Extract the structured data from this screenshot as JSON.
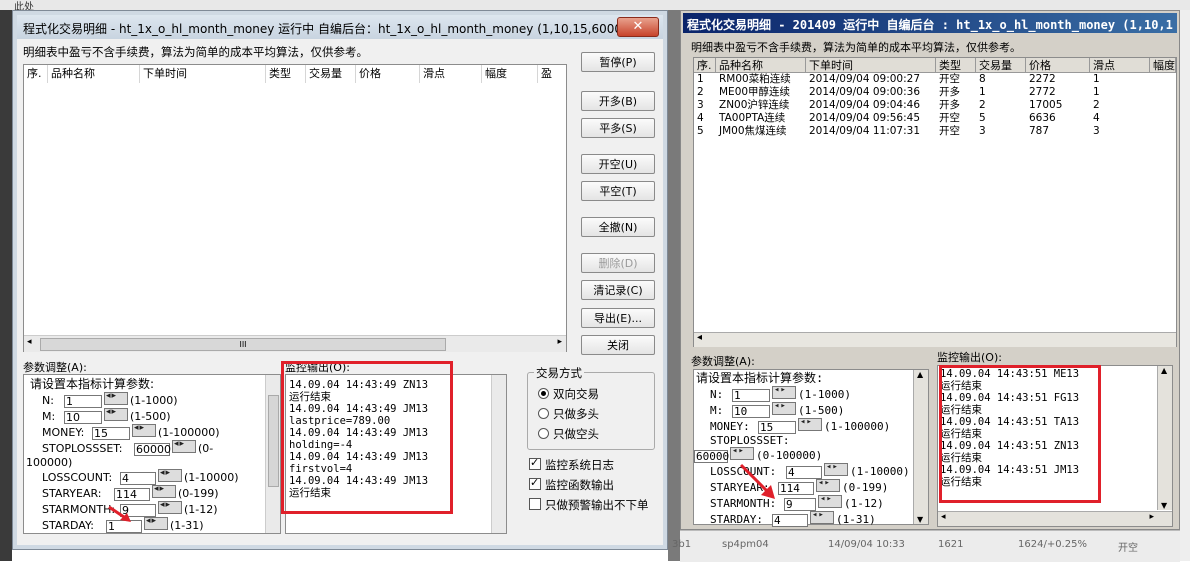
{
  "background": {
    "top_text": "此处",
    "bottom_cells": [
      "3b1",
      "sp4pm04",
      "14/09/04 10:33",
      "1621",
      "1624/+0.25%",
      "开空"
    ]
  },
  "window1": {
    "title": "程式化交易明细 - ht_1x_o_hl_month_money 运行中  自编后台：ht_1x_o_hl_month_money (1,10,15,6000...",
    "close_label": "✕",
    "note": "明细表中盈亏不含手续费，算法为简单的成本平均算法，仅供参考。",
    "columns": [
      "序.",
      "品种名称",
      "下单时间",
      "类型",
      "交易量",
      "价格",
      "滑点",
      "幅度",
      "盈"
    ],
    "buttons": {
      "pause": "暂停(P)",
      "open_long": "开多(B)",
      "close_long": "平多(S)",
      "open_short": "开空(U)",
      "close_short": "平空(T)",
      "cancel_all": "全撤(N)",
      "delete": "删除(D)",
      "clear_records": "清记录(C)",
      "export": "导出(E)...",
      "close": "关闭"
    },
    "hscroll_thumb_label": "III",
    "params_label": "参数调整(A):",
    "params": {
      "heading": "请设置本指标计算参数:",
      "n": {
        "label": "N:",
        "value": "1",
        "range": "(1-1000)"
      },
      "m": {
        "label": "M:",
        "value": "10",
        "range": "(1-500)"
      },
      "money": {
        "label": "MONEY:",
        "value": "15",
        "range": "(1-100000)"
      },
      "stoploss": {
        "label": "STOPLOSSSET:",
        "value": "60000",
        "range": "(0-",
        "range2": "100000)"
      },
      "losscount": {
        "label": "LOSSCOUNT:",
        "value": "4",
        "range": "(1-10000)"
      },
      "staryear": {
        "label": "STARYEAR:",
        "value": "114",
        "range": "(0-199)"
      },
      "starmonth": {
        "label": "STARMONTH:",
        "value": "9",
        "range": "(1-12)"
      },
      "starday": {
        "label": "STARDAY:",
        "value": "1",
        "range": "(1-31)"
      }
    },
    "monitor_label": "监控输出(O):",
    "monitor_lines": [
      "14.09.04 14:43:49 ZN13",
      "运行结束",
      "14.09.04 14:43:49 JM13",
      "lastprice=789.00",
      "14.09.04 14:43:49 JM13",
      "holding=-4",
      "14.09.04 14:43:49 JM13",
      "firstvol=4",
      "14.09.04 14:43:49 JM13",
      "运行结束"
    ],
    "trade_mode": {
      "label": "交易方式",
      "options": [
        "双向交易",
        "只做多头",
        "只做空头"
      ],
      "selected": 0
    },
    "checks": [
      {
        "label": "监控系统日志",
        "checked": true
      },
      {
        "label": "监控函数输出",
        "checked": true
      },
      {
        "label": "只做预警输出不下单",
        "checked": false
      }
    ]
  },
  "window2": {
    "title": "程式化交易明细 - 201409 运行中  自编后台 : ht_1x_o_hl_month_money (1,10,1",
    "note": "明细表中盈亏不含手续费，算法为简单的成本平均算法，仅供参考。",
    "columns": [
      "序.",
      "品种名称",
      "下单时间",
      "类型",
      "交易量",
      "价格",
      "滑点",
      "幅度"
    ],
    "rows": [
      [
        "1",
        "RM00菜粕连续",
        "2014/09/04 09:00:27",
        "开空",
        "8",
        "2272",
        "1"
      ],
      [
        "2",
        "ME00甲醇连续",
        "2014/09/04 09:00:36",
        "开多",
        "1",
        "2772",
        "1"
      ],
      [
        "3",
        "ZN00沪锌连续",
        "2014/09/04 09:04:46",
        "开多",
        "2",
        "17005",
        "2"
      ],
      [
        "4",
        "TA00PTA连续",
        "2014/09/04 09:56:45",
        "开空",
        "5",
        "6636",
        "4"
      ],
      [
        "5",
        "JM00焦煤连续",
        "2014/09/04 11:07:31",
        "开空",
        "3",
        "787",
        "3"
      ]
    ],
    "params_label": "参数调整(A):",
    "params": {
      "heading": "请设置本指标计算参数:",
      "n": {
        "label": "N:",
        "value": "1",
        "range": "(1-1000)"
      },
      "m": {
        "label": "M:",
        "value": "10",
        "range": "(1-500)"
      },
      "money": {
        "label": "MONEY:",
        "value": "15",
        "range": "(1-100000)"
      },
      "stoploss": {
        "label": "STOPLOSSSET:",
        "value": "60000",
        "range": "(0-100000)"
      },
      "losscount": {
        "label": "LOSSCOUNT:",
        "value": "4",
        "range": "(1-10000)"
      },
      "staryear": {
        "label": "STARYEAR:",
        "value": "114",
        "range": "(0-199)"
      },
      "starmonth": {
        "label": "STARMONTH:",
        "value": "9",
        "range": "(1-12)"
      },
      "starday": {
        "label": "STARDAY:",
        "value": "4",
        "range": "(1-31)"
      }
    },
    "monitor_label": "监控输出(O):",
    "monitor_lines": [
      "14.09.04 14:43:51 ME13",
      "运行结束",
      "14.09.04 14:43:51 FG13",
      "运行结束",
      "14.09.04 14:43:51 TA13",
      "运行结束",
      "14.09.04 14:43:51 ZN13",
      "运行结束",
      "14.09.04 14:43:51 JM13",
      "运行结束"
    ]
  },
  "colors": {
    "highlight": "#e0202a",
    "arrow": "#e0202a",
    "title2_start": "#0a246a"
  }
}
